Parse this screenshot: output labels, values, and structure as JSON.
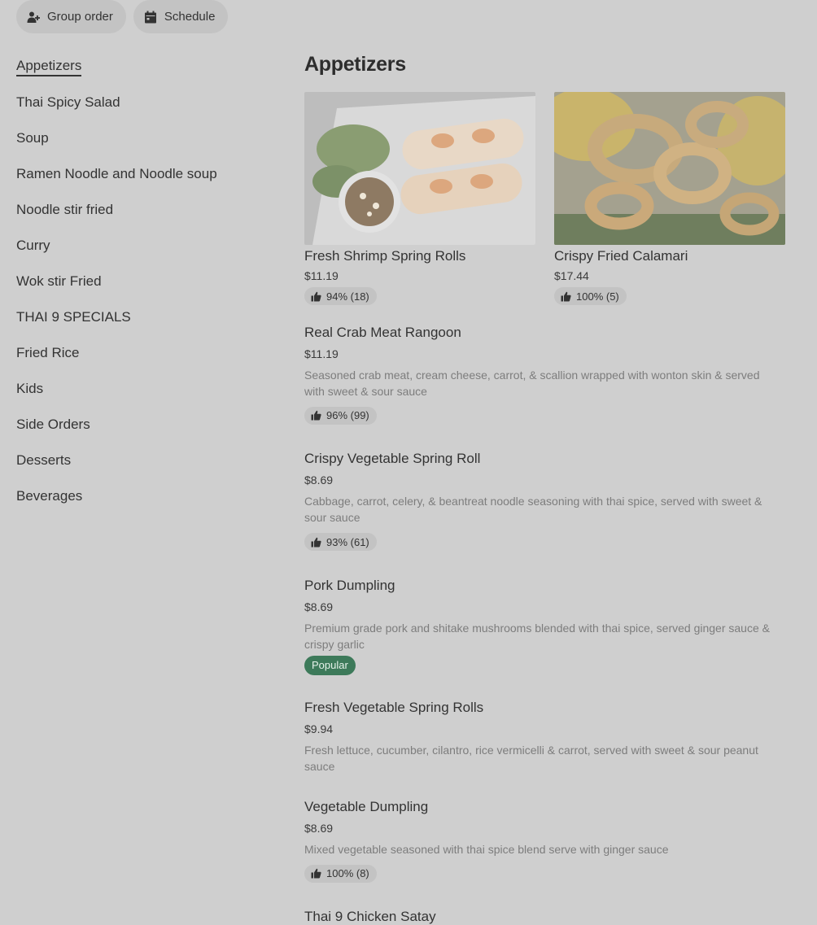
{
  "top_actions": {
    "group_order": "Group order",
    "schedule": "Schedule"
  },
  "sidebar": {
    "items": [
      "Appetizers",
      "Thai Spicy Salad",
      "Soup",
      "Ramen Noodle and Noodle soup",
      "Noodle stir fried",
      "Curry",
      "Wok stir Fried",
      "THAI 9 SPECIALS",
      "Fried Rice",
      "Kids",
      "Side Orders",
      "Desserts",
      "Beverages"
    ]
  },
  "section": {
    "title": "Appetizers",
    "cards": [
      {
        "name": "Fresh Shrimp Spring Rolls",
        "price": "$11.19",
        "rating": "94% (18)"
      },
      {
        "name": "Crispy Fried Calamari",
        "price": "$17.44",
        "rating": "100% (5)"
      }
    ],
    "items": [
      {
        "name": "Real Crab Meat Rangoon",
        "price": "$11.19",
        "desc": "Seasoned crab meat, cream cheese, carrot, & scallion wrapped with wonton skin & served with sweet & sour sauce",
        "rating": "96% (99)"
      },
      {
        "name": "Crispy Vegetable Spring Roll",
        "price": "$8.69",
        "desc": "Cabbage, carrot, celery, & beantreat noodle seasoning with thai spice, served with sweet & sour sauce",
        "rating": "93% (61)"
      },
      {
        "name": "Pork Dumpling",
        "price": "$8.69",
        "desc": "Premium grade pork and shitake mushrooms blended with thai spice, served ginger sauce & crispy garlic",
        "badge": "Popular"
      },
      {
        "name": "Fresh Vegetable Spring Rolls",
        "price": "$9.94",
        "desc": "Fresh lettuce, cucumber, cilantro, rice vermicelli & carrot, served with sweet & sour peanut sauce"
      },
      {
        "name": "Vegetable Dumpling",
        "price": "$8.69",
        "desc": "Mixed vegetable seasoned with thai spice blend serve with ginger sauce",
        "rating": "100% (8)"
      },
      {
        "name": "Thai 9 Chicken Satay"
      }
    ]
  },
  "icons": {
    "group": "add-person-icon",
    "schedule": "calendar-icon",
    "rating": "thumbs-up-icon"
  },
  "colors": {
    "background": "#cfcfcf",
    "pill": "#c3c3c3",
    "popular_badge": "#3d7a5a"
  }
}
